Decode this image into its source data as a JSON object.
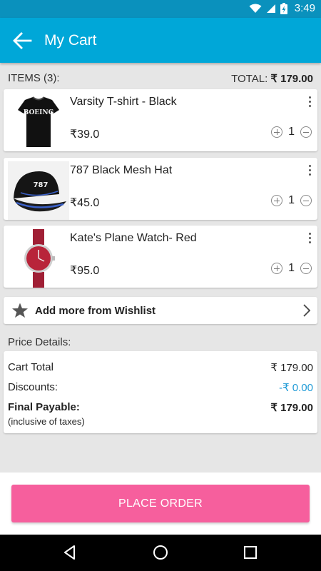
{
  "status_bar": {
    "time": "3:49",
    "icons": [
      "wifi-icon",
      "signal-icon",
      "battery-charging-icon"
    ]
  },
  "app_bar": {
    "title": "My Cart",
    "back_icon": "arrow-left-icon"
  },
  "summary": {
    "items_label": "ITEMS (3):",
    "total_label": "TOTAL:",
    "total_value": "₹ 179.00"
  },
  "cart_items": [
    {
      "name": "Varsity T-shirt - Black",
      "price": "₹39.0",
      "quantity": "1",
      "image": "black-tshirt-boeing"
    },
    {
      "name": "787 Black Mesh Hat",
      "price": "₹45.0",
      "quantity": "1",
      "image": "black-cap-787"
    },
    {
      "name": "Kate's Plane Watch- Red",
      "price": "₹95.0",
      "quantity": "1",
      "image": "red-watch"
    }
  ],
  "wishlist": {
    "label": "Add more from Wishlist",
    "icon": "star-icon"
  },
  "price_details": {
    "title": "Price Details:",
    "cart_total_label": "Cart Total",
    "cart_total_value": "₹ 179.00",
    "discounts_label": "Discounts:",
    "discounts_value": "-₹ 0.00",
    "final_label": "Final Payable:",
    "final_value": "₹ 179.00",
    "tax_note": "(inclusive of taxes)"
  },
  "place_order": {
    "label": "PLACE ORDER"
  },
  "colors": {
    "status_bar": "#0a91bd",
    "app_bar": "#00a7d8",
    "accent_button": "#f65f9d",
    "discount_text": "#1e9ad6",
    "background": "#e6e6e6"
  }
}
